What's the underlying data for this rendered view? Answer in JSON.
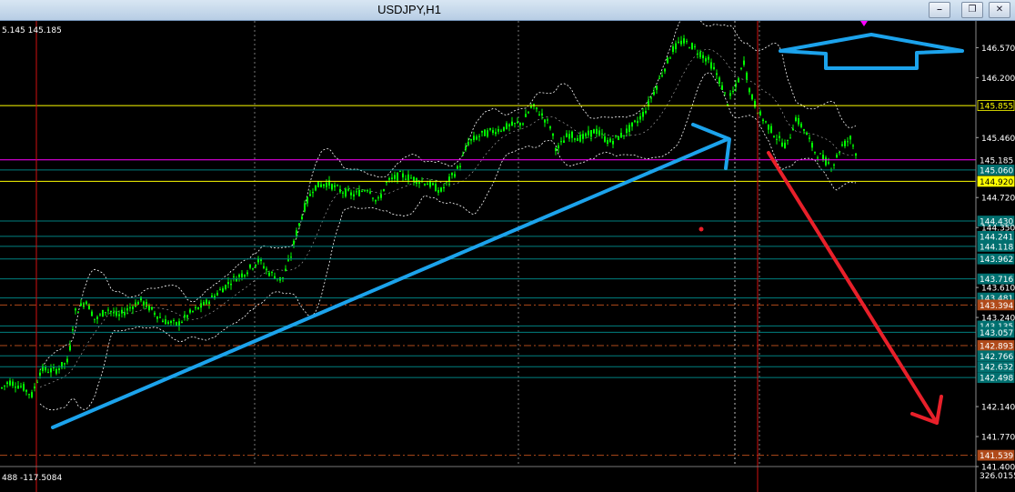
{
  "window": {
    "title": "USDJPY,H1",
    "minimize_icon": "minimize-icon",
    "restore_icon": "restore-icon",
    "close_icon": "close-icon"
  },
  "top_left_readout": "5.145 145.185",
  "indicator_readout": "488 -117.5084",
  "indicator_axis_value": "326.0155",
  "colors": {
    "background": "#000000",
    "candle": "#00ff00",
    "bollinger": "#ffffff",
    "current_price_line": "#ff00ff",
    "yellow_line": "#ffff00",
    "level_line": "#008080",
    "level_label_bg": "#007070",
    "brown_line": "#b04a1a",
    "brown_label_bg": "#b04a1a",
    "blue_annotation": "#1ca3ec",
    "red_annotation": "#e8202a"
  },
  "chart_data": {
    "type": "candlestick",
    "symbol": "USDJPY",
    "timeframe": "H1",
    "ylim": [
      141.4,
      146.9
    ],
    "y_tick_labels": [
      "146.570",
      "146.200",
      "145.460",
      "144.720",
      "144.350",
      "143.610",
      "143.240",
      "142.140",
      "141.770",
      "141.400"
    ],
    "price_path": [
      [
        0,
        142.35
      ],
      [
        10,
        142.45
      ],
      [
        25,
        142.38
      ],
      [
        35,
        142.28
      ],
      [
        45,
        142.6
      ],
      [
        60,
        142.58
      ],
      [
        75,
        142.7
      ],
      [
        82,
        143.3
      ],
      [
        95,
        143.45
      ],
      [
        105,
        143.2
      ],
      [
        118,
        143.35
      ],
      [
        130,
        143.25
      ],
      [
        145,
        143.38
      ],
      [
        155,
        143.45
      ],
      [
        165,
        143.35
      ],
      [
        180,
        143.2
      ],
      [
        195,
        143.15
      ],
      [
        210,
        143.3
      ],
      [
        225,
        143.4
      ],
      [
        240,
        143.55
      ],
      [
        255,
        143.7
      ],
      [
        270,
        143.8
      ],
      [
        285,
        143.95
      ],
      [
        295,
        143.8
      ],
      [
        310,
        143.7
      ],
      [
        320,
        144.0
      ],
      [
        325,
        144.25
      ],
      [
        335,
        144.6
      ],
      [
        345,
        144.85
      ],
      [
        360,
        144.9
      ],
      [
        375,
        144.8
      ],
      [
        390,
        144.75
      ],
      [
        405,
        144.85
      ],
      [
        415,
        144.65
      ],
      [
        425,
        144.9
      ],
      [
        440,
        145.0
      ],
      [
        455,
        144.95
      ],
      [
        470,
        144.9
      ],
      [
        485,
        144.8
      ],
      [
        495,
        144.95
      ],
      [
        505,
        145.1
      ],
      [
        515,
        145.4
      ],
      [
        530,
        145.5
      ],
      [
        545,
        145.55
      ],
      [
        560,
        145.6
      ],
      [
        575,
        145.65
      ],
      [
        585,
        145.85
      ],
      [
        595,
        145.75
      ],
      [
        605,
        145.6
      ],
      [
        612,
        145.3
      ],
      [
        625,
        145.5
      ],
      [
        640,
        145.45
      ],
      [
        655,
        145.55
      ],
      [
        670,
        145.4
      ],
      [
        685,
        145.5
      ],
      [
        700,
        145.65
      ],
      [
        710,
        145.8
      ],
      [
        720,
        146.05
      ],
      [
        730,
        146.3
      ],
      [
        740,
        146.55
      ],
      [
        750,
        146.65
      ],
      [
        760,
        146.6
      ],
      [
        770,
        146.5
      ],
      [
        780,
        146.4
      ],
      [
        790,
        146.2
      ],
      [
        800,
        145.9
      ],
      [
        810,
        146.1
      ],
      [
        818,
        146.4
      ],
      [
        825,
        146.0
      ],
      [
        835,
        145.75
      ],
      [
        845,
        145.6
      ],
      [
        855,
        145.45
      ],
      [
        865,
        145.35
      ],
      [
        875,
        145.7
      ],
      [
        885,
        145.55
      ],
      [
        895,
        145.3
      ],
      [
        905,
        145.2
      ],
      [
        915,
        145.1
      ],
      [
        925,
        145.35
      ],
      [
        935,
        145.45
      ],
      [
        942,
        145.25
      ]
    ],
    "bollinger_width": 0.25,
    "horizontal_levels": [
      {
        "price": 145.855,
        "label": "145.855",
        "color": "#ffff00",
        "style": "solid",
        "label_bg": "#000000",
        "label_fg": "#ffff00",
        "label_border": "#ffff00"
      },
      {
        "price": 145.185,
        "label": "145.185",
        "color": "#ff00ff",
        "style": "solid",
        "label_bg": "#000000",
        "label_fg": "#ffffff",
        "label_border": "#000000"
      },
      {
        "price": 145.06,
        "label": "145.060",
        "color": "#008080",
        "style": "solid",
        "label_bg": "#007070",
        "label_fg": "#ffffff",
        "label_border": "#007070"
      },
      {
        "price": 144.92,
        "label": "144.920",
        "color": "#ffff00",
        "style": "solid",
        "label_bg": "#ffff00",
        "label_fg": "#000000",
        "label_border": "#ffff00"
      },
      {
        "price": 144.43,
        "label": "144.430",
        "color": "#008080",
        "style": "solid",
        "label_bg": "#007070",
        "label_fg": "#ffffff",
        "label_border": "#007070"
      },
      {
        "price": 144.241,
        "label": "144.241",
        "color": "#008080",
        "style": "solid",
        "label_bg": "#007070",
        "label_fg": "#ffffff",
        "label_border": "#007070"
      },
      {
        "price": 144.118,
        "label": "144.118",
        "color": "#008080",
        "style": "solid",
        "label_bg": "#007070",
        "label_fg": "#ffffff",
        "label_border": "#007070"
      },
      {
        "price": 143.962,
        "label": "143.962",
        "color": "#008080",
        "style": "solid",
        "label_bg": "#007070",
        "label_fg": "#ffffff",
        "label_border": "#007070"
      },
      {
        "price": 143.716,
        "label": "143.716",
        "color": "#008080",
        "style": "solid",
        "label_bg": "#007070",
        "label_fg": "#ffffff",
        "label_border": "#007070"
      },
      {
        "price": 143.481,
        "label": "143.481",
        "color": "#008080",
        "style": "solid",
        "label_bg": "#007070",
        "label_fg": "#ffffff",
        "label_border": "#007070"
      },
      {
        "price": 143.394,
        "label": "143.394",
        "color": "#b04a1a",
        "style": "dashdot",
        "label_bg": "#b04a1a",
        "label_fg": "#ffffff",
        "label_border": "#b04a1a"
      },
      {
        "price": 143.135,
        "label": "143.135",
        "color": "#008080",
        "style": "solid",
        "label_bg": "#007070",
        "label_fg": "#ffffff",
        "label_border": "#007070"
      },
      {
        "price": 143.057,
        "label": "143.057",
        "color": "#008080",
        "style": "solid",
        "label_bg": "#007070",
        "label_fg": "#ffffff",
        "label_border": "#007070"
      },
      {
        "price": 142.893,
        "label": "142.893",
        "color": "#b04a1a",
        "style": "dashdot",
        "label_bg": "#b04a1a",
        "label_fg": "#ffffff",
        "label_border": "#b04a1a"
      },
      {
        "price": 142.766,
        "label": "142.766",
        "color": "#008080",
        "style": "solid",
        "label_bg": "#007070",
        "label_fg": "#ffffff",
        "label_border": "#007070"
      },
      {
        "price": 142.632,
        "label": "142.632",
        "color": "#008080",
        "style": "solid",
        "label_bg": "#007070",
        "label_fg": "#ffffff",
        "label_border": "#007070"
      },
      {
        "price": 142.498,
        "label": "142.498",
        "color": "#008080",
        "style": "solid",
        "label_bg": "#007070",
        "label_fg": "#ffffff",
        "label_border": "#007070"
      },
      {
        "price": 141.539,
        "label": "141.539",
        "color": "#b04a1a",
        "style": "dashdot",
        "label_bg": "#b04a1a",
        "label_fg": "#ffffff",
        "label_border": "#b04a1a"
      }
    ],
    "grid": true
  }
}
